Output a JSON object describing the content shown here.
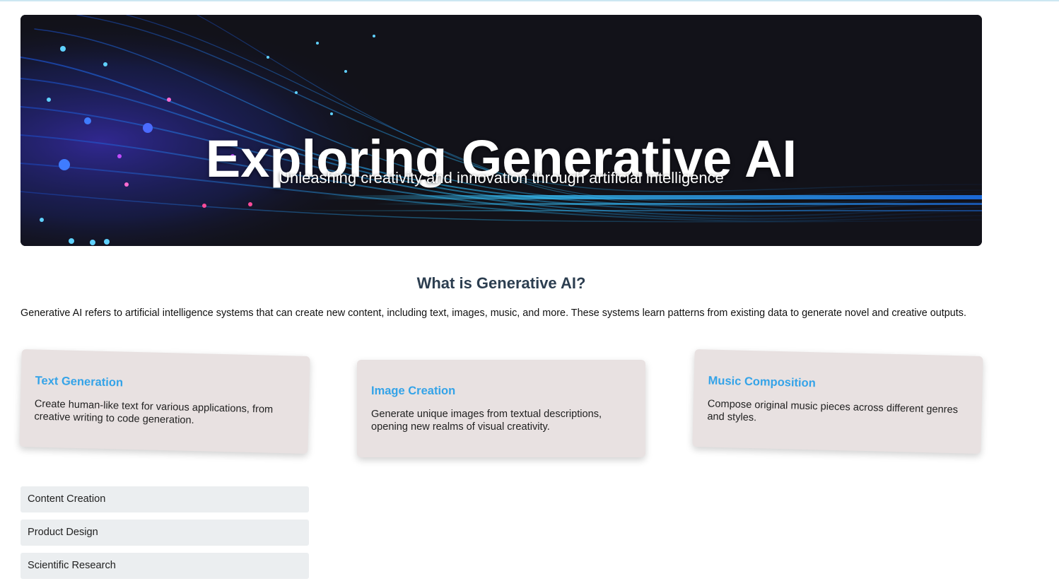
{
  "hero": {
    "title": "Exploring Generative AI",
    "subtitle": "Unleashing creativity and innovation through artificial intelligence"
  },
  "intro": {
    "heading": "What is Generative AI?",
    "text": "Generative AI refers to artificial intelligence systems that can create new content, including text, images, music, and more. These systems learn patterns from existing data to generate novel and creative outputs."
  },
  "cards": [
    {
      "title": "Text Generation",
      "text": "Create human-like text for various applications, from creative writing to code generation."
    },
    {
      "title": "Image Creation",
      "text": "Generate unique images from textual descriptions, opening new realms of visual creativity."
    },
    {
      "title": "Music Composition",
      "text": "Compose original music pieces across different genres and styles."
    }
  ],
  "applications": [
    "Content Creation",
    "Product Design",
    "Scientific Research"
  ],
  "colors": {
    "hero_background": "#121219",
    "card_title": "#34a3e8",
    "card_background": "#e8e1e1",
    "heading": "#2c3e50",
    "list_item_background": "#ebeef0"
  }
}
